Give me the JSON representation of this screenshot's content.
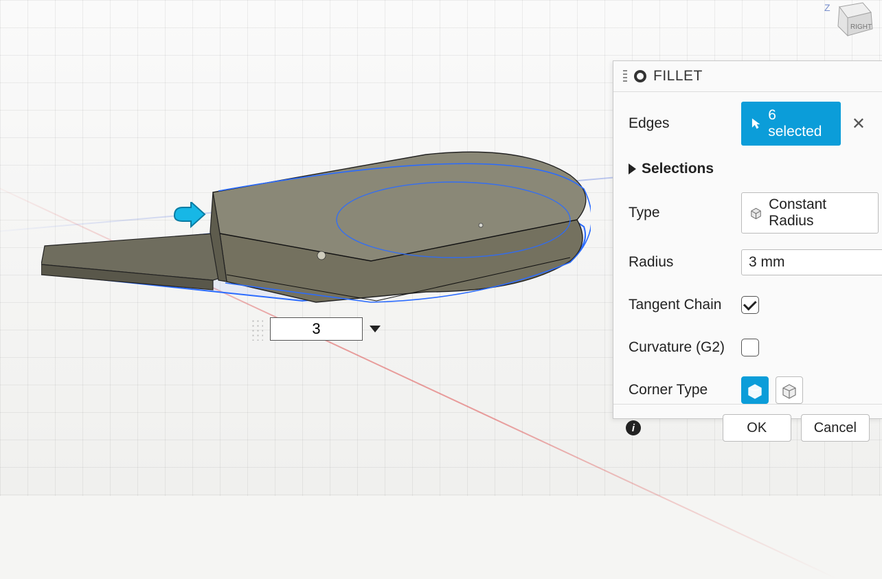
{
  "panel": {
    "title": "FILLET",
    "edges_label": "Edges",
    "edges_chip": "6 selected",
    "selections_label": "Selections",
    "type_label": "Type",
    "type_value": "Constant Radius",
    "radius_label": "Radius",
    "radius_value": "3 mm",
    "tangent_chain_label": "Tangent Chain",
    "tangent_chain_checked": true,
    "curvature_label": "Curvature (G2)",
    "curvature_checked": false,
    "corner_type_label": "Corner Type",
    "ok_label": "OK",
    "cancel_label": "Cancel"
  },
  "direct_input": {
    "value": "3"
  },
  "viewcube": {
    "z_label": "Z",
    "face_label": "RIGHT"
  }
}
